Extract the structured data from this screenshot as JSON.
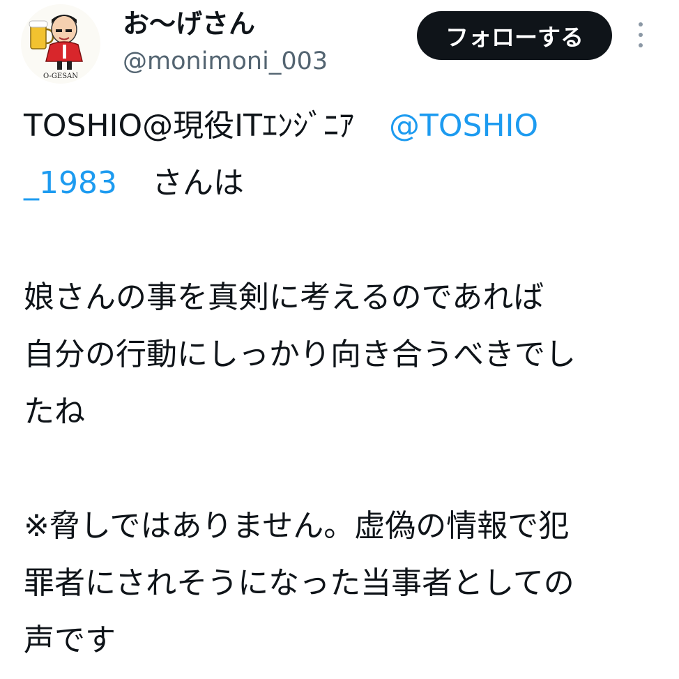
{
  "author": {
    "display_name": "お〜げさん",
    "handle": "@monimoni_003",
    "avatar_caption": "O-GESAN"
  },
  "header": {
    "follow_label": "フォローする",
    "more_icon": "more-vertical-icon"
  },
  "tweet": {
    "line1_text": "TOSHIO@現役ITｴﾝｼﾞﾆｱ",
    "mention_part1": "@TOSHIO",
    "mention_part2": "_1983",
    "line2_suffix": "さんは",
    "p2_line1": "娘さんの事を真剣に考えるのであれば",
    "p2_line2": "自分の行動にしっかり向き合うべきでし",
    "p2_line3": "たね",
    "p3_line1": "※脅しではありません。虚偽の情報で犯",
    "p3_line2": "罪者にされそうになった当事者としての",
    "p3_line3": "声です"
  },
  "colors": {
    "link": "#1d9bf0",
    "text": "#0f1419",
    "secondary": "#536471",
    "button_bg": "#0f1419"
  }
}
